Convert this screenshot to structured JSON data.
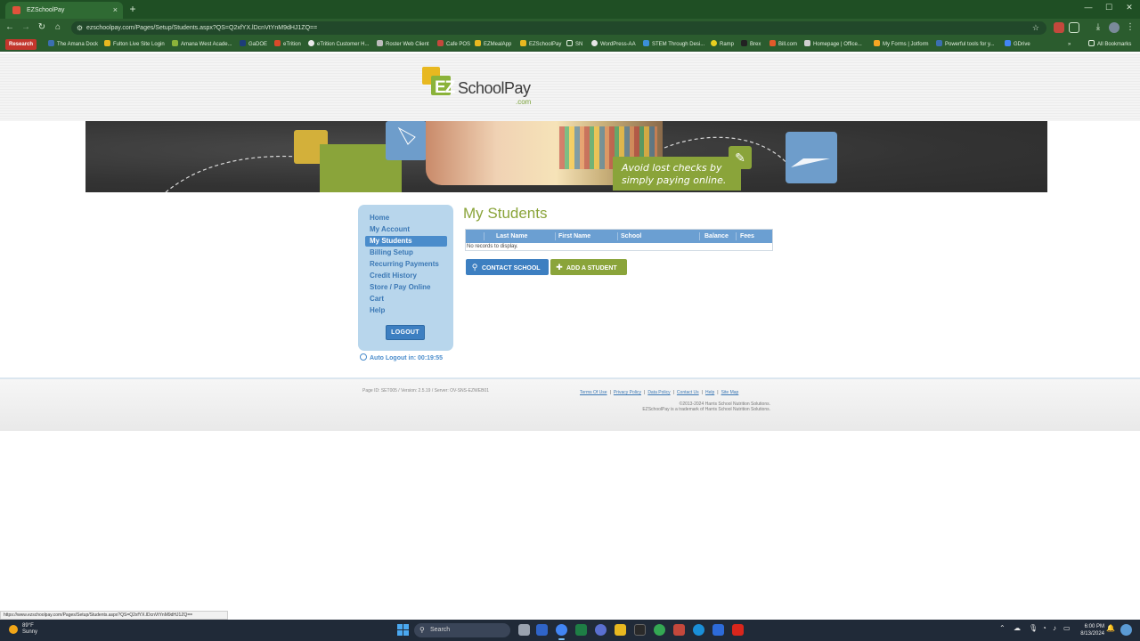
{
  "browser": {
    "tab_title": "EZSchoolPay",
    "tab_close": "×",
    "new_tab": "+",
    "url": "ezschoolpay.com/Pages/Setup/Students.aspx?QS=Q2xfYX.lDcnVtYnM9dHJ1ZQ==",
    "bookmarks": [
      "Research",
      "The Amana Dock",
      "Fulton Live Site Login",
      "Amana West Acade...",
      "GaDOE",
      "eTrition",
      "eTrition Customer H...",
      "Roster Web Client",
      "Cafe POS",
      "EZMealApp",
      "EZSchoolPay",
      "SN",
      "WordPress-AA",
      "STEM Through Desi...",
      "Ramp",
      "Brex",
      "Bill.com",
      "Homepage | Office...",
      "My Forms | Jotform",
      "Powerful tools for y...",
      "GDrive"
    ],
    "all_bookmarks": "All Bookmarks",
    "more_bookmarks": "»",
    "status_url": "https://www.ezschoolpay.com/Pages/Setup/Students.aspx?QS=Q2xfYX.lDcnVtYnM9dHJ1ZQ=="
  },
  "logo": {
    "ez": "EZ",
    "name": "SchoolPay",
    "tld": ".com"
  },
  "banner": {
    "tagline_1": "Avoid lost checks by",
    "tagline_2": "simply paying online."
  },
  "sidebar": {
    "items": [
      {
        "label": "Home"
      },
      {
        "label": "My Account"
      },
      {
        "label": "My Students"
      },
      {
        "label": "Billing Setup"
      },
      {
        "label": "Recurring Payments"
      },
      {
        "label": "Credit History"
      },
      {
        "label": "Store / Pay Online"
      },
      {
        "label": "Cart"
      },
      {
        "label": "Help"
      }
    ],
    "active_index": 2,
    "logout_label": "LOGOUT",
    "auto_logout": "Auto Logout in: 00:19:55"
  },
  "main": {
    "title": "My Students",
    "columns": [
      "Last Name",
      "First Name",
      "School",
      "Balance",
      "Fees"
    ],
    "empty_text": "No records to display.",
    "contact_label": "CONTACT SCHOOL",
    "add_label": "ADD A STUDENT"
  },
  "footer": {
    "page_id": "Page ID: SET005 / Version: 2.5.19 / Server: OV-SNS-EZWEB01",
    "links": [
      "Terms Of Use",
      "Privacy Policy",
      "Data Policy",
      "Contact Us",
      "Help",
      "Site Map"
    ],
    "copyright_1": "©2013-2024 Harris School Nutrition Solutions.",
    "copyright_2": "EZSchoolPay is a trademark of Harris School Nutrition Solutions."
  },
  "taskbar": {
    "temp": "89°F",
    "weather": "Sunny",
    "search": "Search",
    "time": "6:00 PM",
    "date": "8/13/2024"
  },
  "colors": {
    "brand_green": "#8aa43a",
    "brand_blue": "#3d7fc1",
    "sidebar_bg": "#b8d6ec",
    "browser_green": "#2b5c2e"
  }
}
